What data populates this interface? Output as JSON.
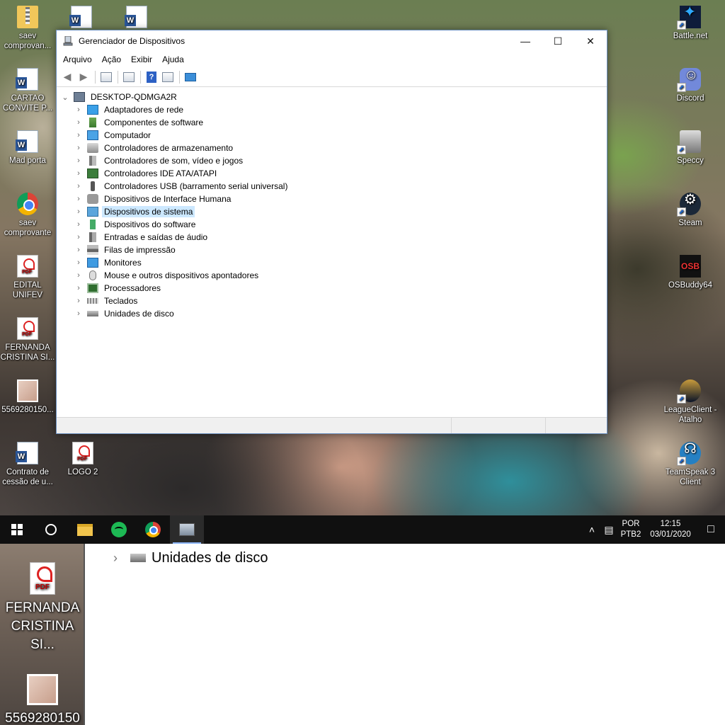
{
  "window": {
    "title": "Gerenciador de Dispositivos",
    "menus": [
      "Arquivo",
      "Ação",
      "Exibir",
      "Ajuda"
    ],
    "tree_root": "DESKTOP-QDMGA2R",
    "categories": [
      "Adaptadores de rede",
      "Componentes de software",
      "Computador",
      "Controladores de armazenamento",
      "Controladores de som, vídeo e jogos",
      "Controladores IDE ATA/ATAPI",
      "Controladores USB (barramento serial universal)",
      "Dispositivos de Interface Humana",
      "Dispositivos de sistema",
      "Dispositivos do software",
      "Entradas e saídas de áudio",
      "Filas de impressão",
      "Monitores",
      "Mouse e outros dispositivos apontadores",
      "Processadores",
      "Teclados",
      "Unidades de disco"
    ],
    "selected_category": "Dispositivos de sistema"
  },
  "desktop": {
    "left_icons": [
      {
        "label": "saev comprovan...",
        "icon": "zip-folder-icon"
      },
      {
        "label": "CARTAO CONVITE P...",
        "icon": "word-doc-icon"
      },
      {
        "label": "Mad porta",
        "icon": "word-doc-icon"
      },
      {
        "label": "saev comprovante",
        "icon": "chrome-icon"
      },
      {
        "label": "EDITAL UNIFEV",
        "icon": "pdf-icon"
      },
      {
        "label": "FERNANDA CRISTINA SI...",
        "icon": "pdf-icon"
      },
      {
        "label": "5569280150...",
        "icon": "image-icon"
      },
      {
        "label": "Contrato de cessão de u...",
        "icon": "word-doc-icon"
      },
      {
        "label": "LOGO 2",
        "icon": "pdf-icon"
      }
    ],
    "right_icons": [
      {
        "label": "Battle.net",
        "icon": "battlenet-icon"
      },
      {
        "label": "Discord",
        "icon": "discord-icon"
      },
      {
        "label": "Speccy",
        "icon": "speccy-icon"
      },
      {
        "label": "Steam",
        "icon": "steam-icon"
      },
      {
        "label": "OSBuddy64",
        "icon": "osbuddy-icon",
        "badge": "OSB"
      },
      {
        "label": "LeagueClient - Atalho",
        "icon": "league-icon"
      },
      {
        "label": "TeamSpeak 3 Client",
        "icon": "teamspeak-icon"
      }
    ]
  },
  "taskbar": {
    "apps": [
      "start-icon",
      "cortana-icon",
      "file-explorer-icon",
      "spotify-icon",
      "chrome-icon",
      "device-manager-icon"
    ],
    "language": "POR",
    "keyboard": "PTB2",
    "time": "12:15",
    "date": "03/01/2020"
  },
  "zoom": {
    "left_labels": [
      "FERNANDA CRISTINA SI...",
      "5569280150"
    ],
    "row_label": "Unidades de disco"
  }
}
